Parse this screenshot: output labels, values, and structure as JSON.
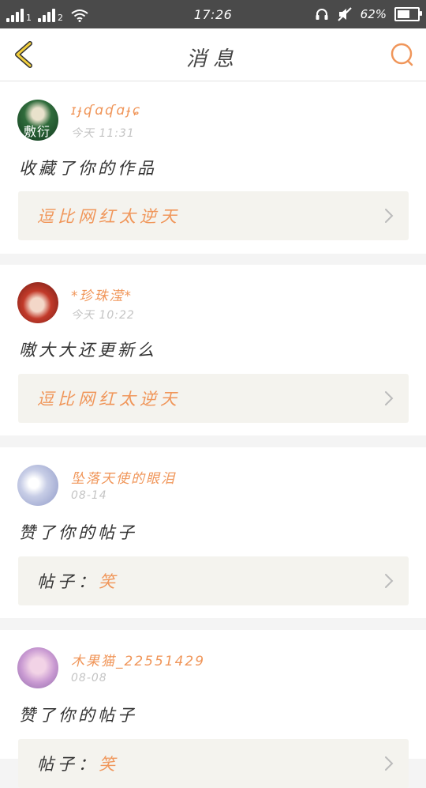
{
  "status_bar": {
    "sim1": "1",
    "sim2": "2",
    "time": "17:26",
    "battery": "62%",
    "battery_level": 0.62
  },
  "header": {
    "title": "消息"
  },
  "messages": [
    {
      "name": "ɪɟʠɑʠɑɟɕ",
      "time": "今天 11:31",
      "content": "收藏了你的作品",
      "ref_prefix": "",
      "ref_text": "逗比网红太逆天",
      "avatar_text": "敷衍"
    },
    {
      "name": "*珍珠滢*",
      "time": "今天 10:22",
      "content": "嗷大大还更新么",
      "ref_prefix": "",
      "ref_text": "逗比网红太逆天"
    },
    {
      "name": "坠落天使的眼泪",
      "time": "08-14",
      "content": "赞了你的帖子",
      "ref_prefix": "帖子：",
      "ref_text": "笑"
    },
    {
      "name": "木果猫_22551429",
      "time": "08-08",
      "content": "赞了你的帖子",
      "ref_prefix": "帖子：",
      "ref_text": "笑"
    }
  ]
}
